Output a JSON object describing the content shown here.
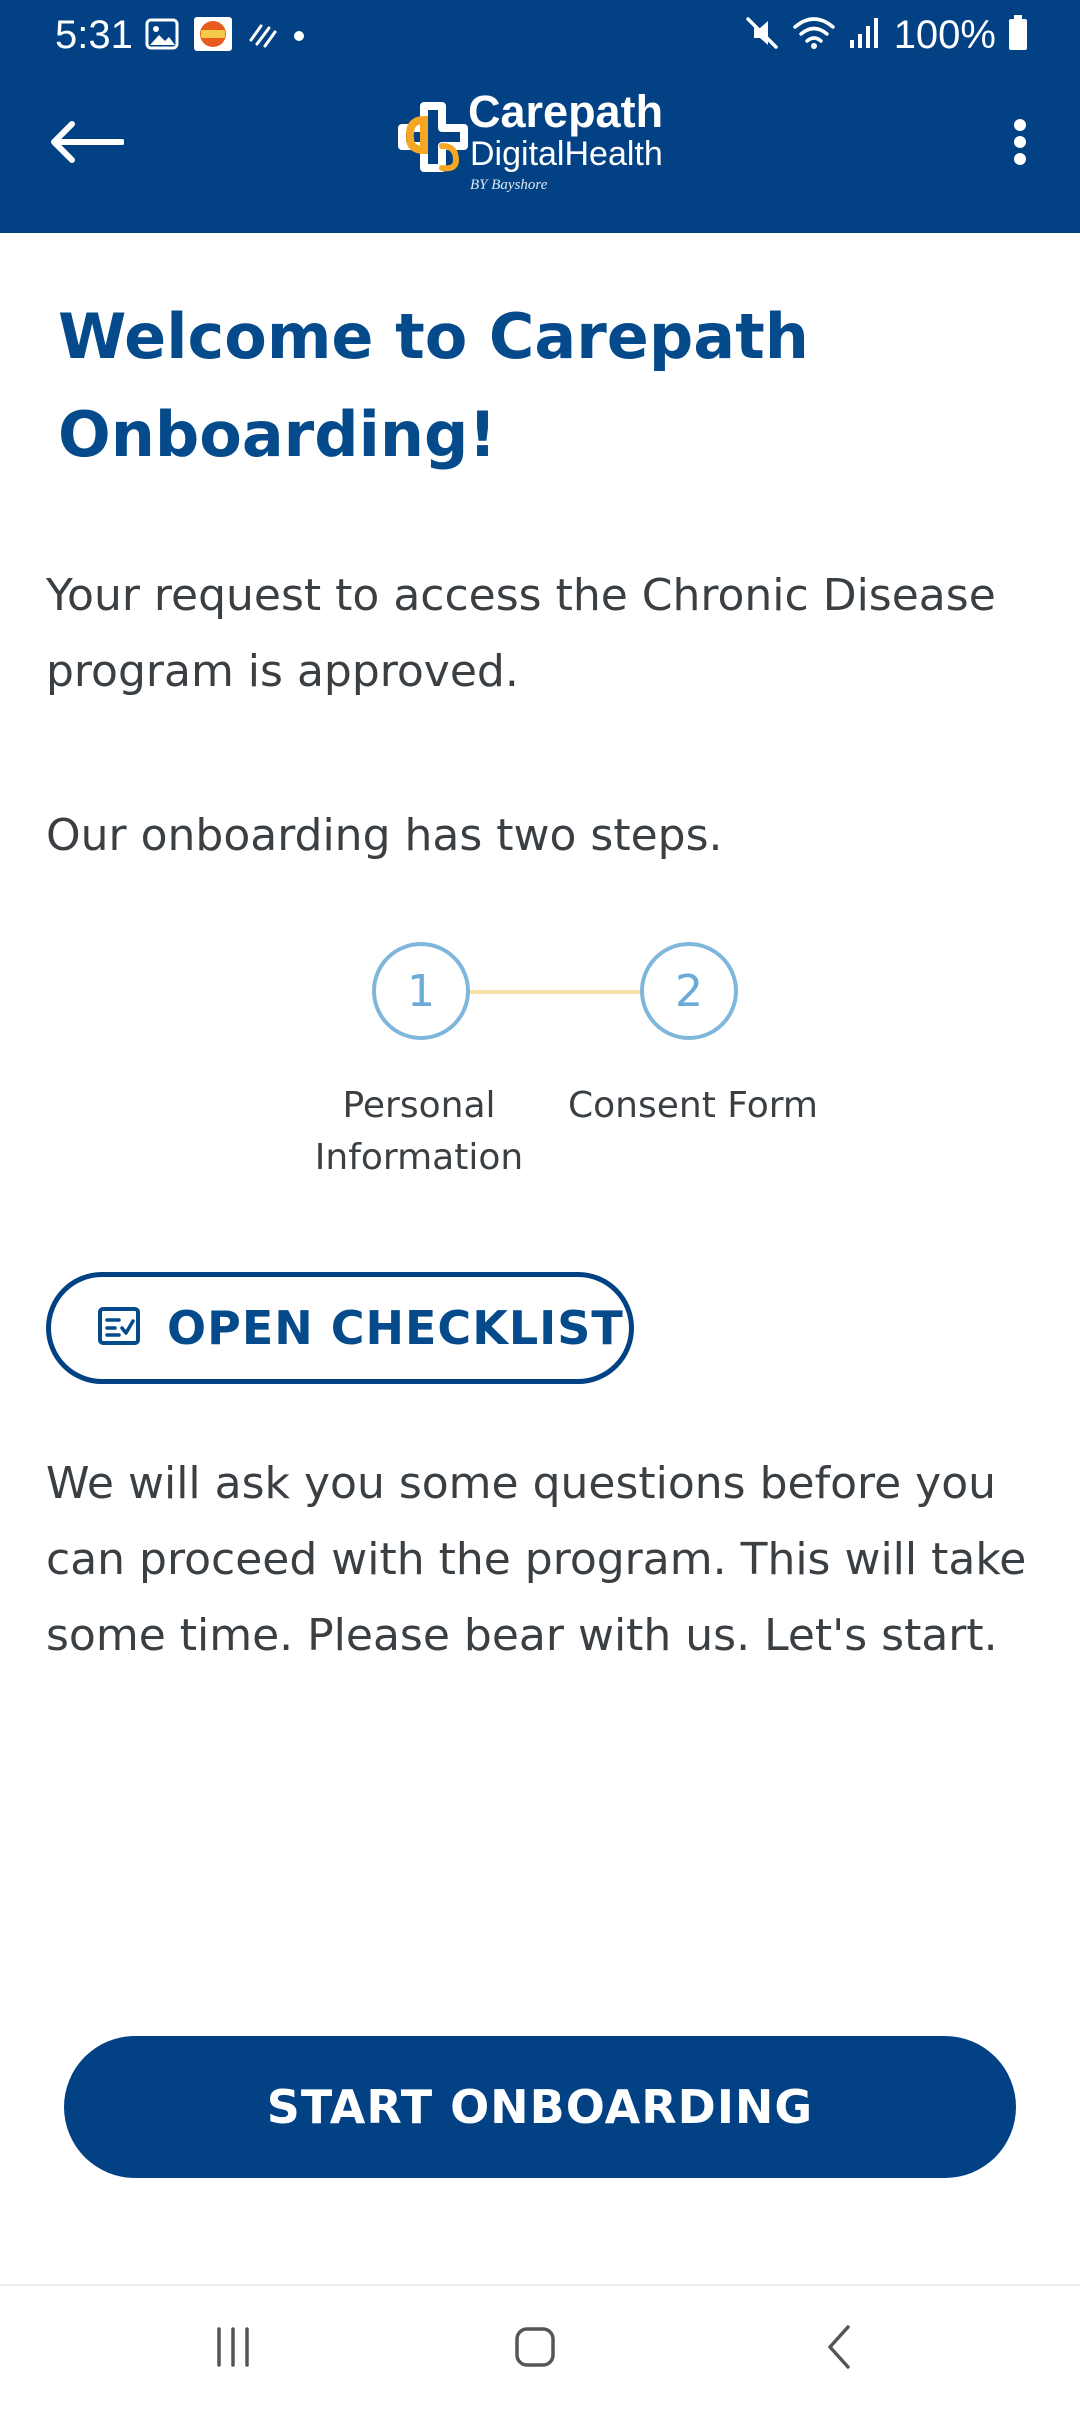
{
  "status_bar": {
    "time": "5:31",
    "battery": "100%",
    "icons_left": [
      "gallery-icon",
      "app-badge-icon",
      "signal-pattern-icon",
      "notification-dot-icon"
    ],
    "icons_right": [
      "mute-icon",
      "wifi-icon",
      "cell-signal-icon",
      "battery-icon"
    ]
  },
  "header": {
    "logo_word1": "Carepath",
    "logo_word2": "DigitalHealth",
    "logo_by": "BY Bayshore",
    "back_icon": "back-arrow-icon",
    "menu_icon": "more-vert-icon"
  },
  "content": {
    "title": "Welcome to Carepath Onboarding!",
    "approved_text": "Your request to access the  Chronic Disease  program is approved.",
    "steps_intro": "Our onboarding has two steps.",
    "steps": [
      {
        "number": "1",
        "label": "Personal Information"
      },
      {
        "number": "2",
        "label": "Consent Form"
      }
    ],
    "checklist_button": "OPEN CHECKLIST",
    "checklist_icon": "checklist-icon",
    "questions_text": "We will ask you some questions before you can proceed with the program. This will take some time. Please bear with us. Let's start.",
    "start_button": "START ONBOARDING"
  },
  "nav_bar": {
    "items": [
      "recents-icon",
      "home-icon",
      "back-icon"
    ]
  },
  "colors": {
    "primary": "#024184",
    "title": "#054a8b",
    "step_circle": "#7fb6db",
    "step_connector": "#f4e2a6",
    "logo_accent": "#f5a623"
  }
}
